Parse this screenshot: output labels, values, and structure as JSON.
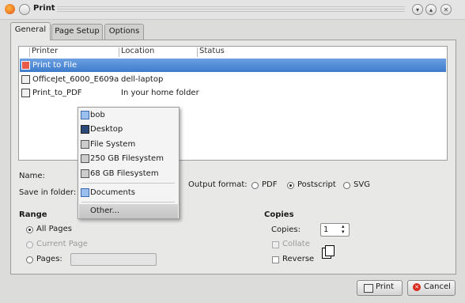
{
  "window": {
    "title": "Print"
  },
  "tabs": [
    "General",
    "Page Setup",
    "Options"
  ],
  "printer_list": {
    "columns": [
      "Printer",
      "Location",
      "Status"
    ],
    "rows": [
      {
        "name": "Print to File",
        "location": "",
        "status": "",
        "selected": true
      },
      {
        "name": "OfficeJet_6000_E609a",
        "location": "dell-laptop",
        "status": ""
      },
      {
        "name": "Print_to_PDF",
        "location": "In your home folder",
        "status": ""
      }
    ]
  },
  "file_settings": {
    "name_label": "Name:",
    "save_in_label": "Save in folder:",
    "output_format_label": "Output format:",
    "formats": [
      "PDF",
      "Postscript",
      "SVG"
    ],
    "selected_format": "Postscript"
  },
  "folder_menu": {
    "items": [
      "bob",
      "Desktop",
      "File System",
      "250 GB Filesystem",
      "68 GB Filesystem",
      "Documents",
      "Other..."
    ],
    "highlighted": "Other..."
  },
  "range": {
    "heading": "Range",
    "options": [
      "All Pages",
      "Current Page",
      "Pages:"
    ],
    "selected": "All Pages"
  },
  "copies": {
    "heading": "Copies",
    "copies_label": "Copies:",
    "copies_value": "1",
    "collate_label": "Collate",
    "reverse_label": "Reverse"
  },
  "buttons": {
    "print": "Print",
    "cancel": "Cancel"
  },
  "colors": {
    "selection": "#3e7ccb",
    "background": "#dcdcda"
  }
}
